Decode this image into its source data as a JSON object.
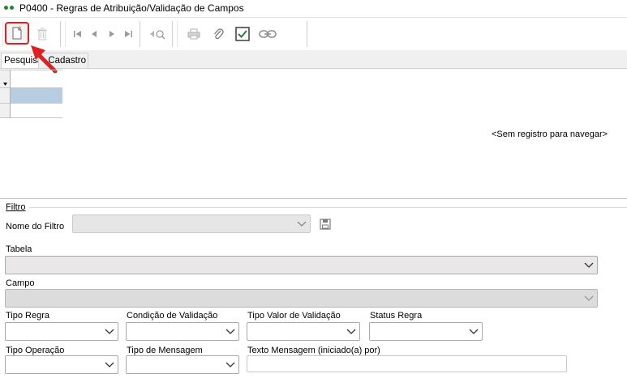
{
  "window": {
    "title": "P0400 - Regras de Atribuição/Validação de Campos"
  },
  "toolbar": {
    "icons": [
      "new-document-icon",
      "delete-icon",
      "first-record-icon",
      "previous-record-icon",
      "next-record-icon",
      "last-record-icon",
      "search-record-icon",
      "print-icon",
      "attach-icon",
      "checkbox-icon",
      "link-icon"
    ]
  },
  "tabs": [
    {
      "label": "Pesquisa",
      "active": true
    },
    {
      "label": "Cadastro",
      "active": false
    }
  ],
  "grid": {
    "empty_message": "<Sem registro para navegar>"
  },
  "filter": {
    "section_label": "Filtro",
    "filter_name_label": "Nome do Filtro",
    "filter_name_value": "",
    "tabela_label": "Tabela",
    "tabela_value": "",
    "campo_label": "Campo",
    "campo_value": "",
    "tipo_regra_label": "Tipo Regra",
    "condicao_label": "Condição de Validação",
    "tipo_valor_label": "Tipo Valor de Validação",
    "status_label": "Status Regra",
    "tipo_operacao_label": "Tipo Operação",
    "tipo_mensagem_label": "Tipo de Mensagem",
    "texto_mensagem_label": "Texto Mensagem (iniciado(a) por)",
    "texto_mensagem_value": ""
  },
  "colors": {
    "accent_red": "#e02020",
    "title_dot": "#1b8a2e",
    "grid_selected_row": "#b9cde2"
  }
}
